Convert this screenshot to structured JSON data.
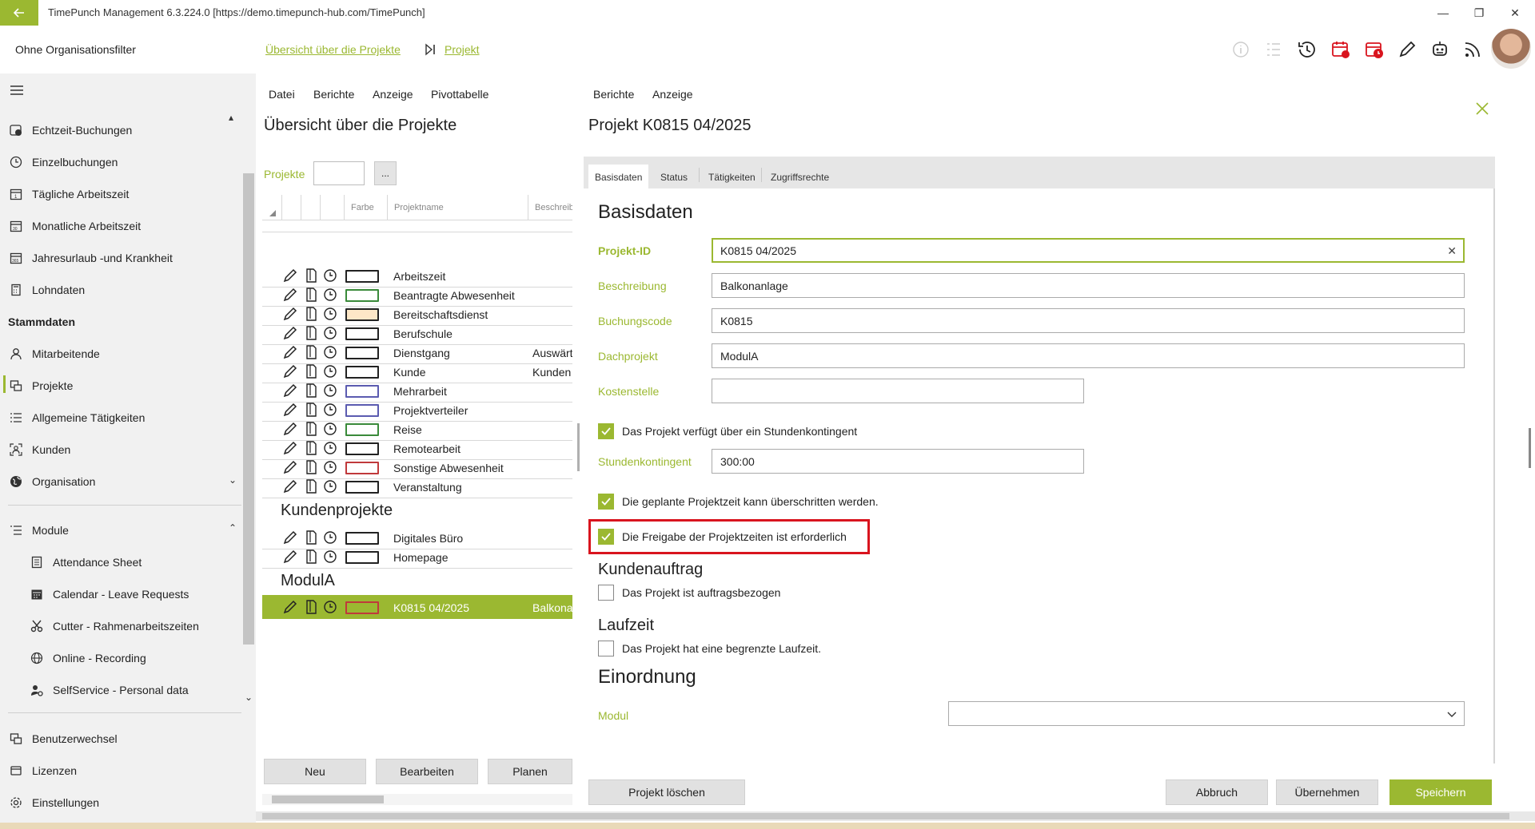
{
  "window": {
    "title": "TimePunch Management 6.3.224.0 [https://demo.timepunch-hub.com/TimePunch]",
    "minimize": "—",
    "restore": "❐",
    "close": "✕"
  },
  "header": {
    "org_filter": "Ohne Organisationsfilter",
    "breadcrumb_overview": "Übersicht über die Projekte",
    "breadcrumb_project": "Projekt",
    "icons": [
      "info-icon",
      "list-icon",
      "history-icon",
      "red-calendar-icon",
      "red-clock-calendar-icon",
      "pencil-icon",
      "robot-icon",
      "feed-icon"
    ]
  },
  "sidebar": {
    "items_top": [
      {
        "label": "Echtzeit-Buchungen",
        "icon": "realtime-clock-icon"
      },
      {
        "label": "Einzelbuchungen",
        "icon": "clock-icon"
      },
      {
        "label": "Tägliche Arbeitszeit",
        "icon": "calendar-day-icon"
      },
      {
        "label": "Monatliche Arbeitszeit",
        "icon": "calendar-month-icon"
      },
      {
        "label": "Jahresurlaub -und Krankheit",
        "icon": "calendar-year-icon"
      },
      {
        "label": "Lohndaten",
        "icon": "calculator-icon"
      }
    ],
    "stammdaten_heading": "Stammdaten",
    "items_stamm": [
      {
        "label": "Mitarbeitende",
        "icon": "person-icon"
      },
      {
        "label": "Projekte",
        "icon": "projects-icon"
      },
      {
        "label": "Allgemeine Tätigkeiten",
        "icon": "list-icon"
      },
      {
        "label": "Kunden",
        "icon": "customer-icon"
      },
      {
        "label": "Organisation",
        "icon": "globe-icon"
      }
    ],
    "module_label": "Module",
    "modules": [
      {
        "label": "Attendance Sheet",
        "icon": "sheet-icon"
      },
      {
        "label": "Calendar - Leave Requests",
        "icon": "calendar-icon"
      },
      {
        "label": "Cutter - Rahmenarbeitszeiten",
        "icon": "scissors-icon"
      },
      {
        "label": "Online - Recording",
        "icon": "globe-icon"
      },
      {
        "label": "SelfService - Personal data",
        "icon": "person-settings-icon"
      }
    ],
    "items_bottom": [
      {
        "label": "Benutzerwechsel",
        "icon": "switch-user-icon"
      },
      {
        "label": "Lizenzen",
        "icon": "key-icon"
      },
      {
        "label": "Einstellungen",
        "icon": "gear-icon"
      }
    ]
  },
  "list_panel": {
    "menu": [
      "Datei",
      "Berichte",
      "Anzeige",
      "Pivottabelle"
    ],
    "title": "Übersicht über die Projekte",
    "filter_label": "Projekte",
    "filter_value": "",
    "filter_button": "...",
    "columns": [
      "Farbe",
      "Projektname",
      "Beschreib"
    ],
    "groups": [
      {
        "name": "",
        "rows": [
          {
            "name": "Arbeitszeit",
            "desc": "",
            "color": "#ffffff",
            "border": "#222222"
          },
          {
            "name": "Beantragte Abwesenheit",
            "desc": "",
            "color": "#ffffff",
            "border": "#3a8a3a"
          },
          {
            "name": "Bereitschaftsdienst",
            "desc": "",
            "color": "#fde7c7",
            "border": "#222222"
          },
          {
            "name": "Berufschule",
            "desc": "",
            "color": "#ffffff",
            "border": "#222222"
          },
          {
            "name": "Dienstgang",
            "desc": "Auswärt",
            "color": "#ffffff",
            "border": "#222222"
          },
          {
            "name": "Kunde",
            "desc": "Kunden",
            "color": "#ffffff",
            "border": "#222222"
          },
          {
            "name": "Mehrarbeit",
            "desc": "",
            "color": "#ffffff",
            "border": "#5b5bb0"
          },
          {
            "name": "Projektverteiler",
            "desc": "",
            "color": "#ffffff",
            "border": "#5b5bb0"
          },
          {
            "name": "Reise",
            "desc": "",
            "color": "#ffffff",
            "border": "#3a8a3a"
          },
          {
            "name": "Remotearbeit",
            "desc": "",
            "color": "#ffffff",
            "border": "#222222"
          },
          {
            "name": "Sonstige Abwesenheit",
            "desc": "",
            "color": "#ffffff",
            "border": "#c0393b"
          },
          {
            "name": "Veranstaltung",
            "desc": "",
            "color": "#ffffff",
            "border": "#222222"
          }
        ]
      },
      {
        "name": "Kundenprojekte",
        "rows": [
          {
            "name": "Digitales Büro",
            "desc": "",
            "color": "#ffffff",
            "border": "#222222"
          },
          {
            "name": "Homepage",
            "desc": "",
            "color": "#ffffff",
            "border": "#222222"
          }
        ]
      },
      {
        "name": "ModulA",
        "rows": [
          {
            "name": "K0815 04/2025",
            "desc": "Balkona",
            "color": "#9bb831",
            "border": "#c0393b",
            "selected": true
          }
        ]
      }
    ],
    "buttons": [
      "Neu",
      "Bearbeiten",
      "Planen"
    ]
  },
  "detail": {
    "menu": [
      "Berichte",
      "Anzeige"
    ],
    "title": "Projekt K0815 04/2025",
    "tabs": [
      "Basisdaten",
      "Status",
      "Tätigkeiten",
      "Zugriffsrechte"
    ],
    "active_tab": "Basisdaten",
    "section": "Basisdaten",
    "fields": {
      "projekt_id": {
        "label": "Projekt-ID",
        "value": "K0815 04/2025"
      },
      "beschreibung": {
        "label": "Beschreibung",
        "value": "Balkonanlage"
      },
      "buchungscode": {
        "label": "Buchungscode",
        "value": "K0815"
      },
      "dachprojekt": {
        "label": "Dachprojekt",
        "value": "ModulA"
      },
      "kostenstelle": {
        "label": "Kostenstelle",
        "value": ""
      },
      "stundenkontingent": {
        "label": "Stundenkontingent",
        "value": "300:00"
      }
    },
    "checkboxes": {
      "kontingent": {
        "label": "Das Projekt verfügt über ein Stundenkontingent",
        "checked": true
      },
      "ueberschreiten": {
        "label": "Die geplante Projektzeit kann überschritten werden.",
        "checked": true
      },
      "freigabe": {
        "label": "Die Freigabe der Projektzeiten ist erforderlich",
        "checked": true
      },
      "auftrag": {
        "label": "Das Projekt ist auftragsbezogen",
        "checked": false
      },
      "laufzeit": {
        "label": "Das Projekt hat eine begrenzte Laufzeit.",
        "checked": false
      }
    },
    "kundenauftrag_heading": "Kundenauftrag",
    "laufzeit_heading": "Laufzeit",
    "einordnung_heading": "Einordnung",
    "modul_label": "Modul",
    "modul_value": "",
    "buttons": {
      "delete": "Projekt löschen",
      "cancel": "Abbruch",
      "apply": "Übernehmen",
      "save": "Speichern"
    }
  },
  "colors": {
    "accent": "#9bb831",
    "highlight": "#d9141e",
    "sidebar_bg": "#f1f1f1"
  }
}
